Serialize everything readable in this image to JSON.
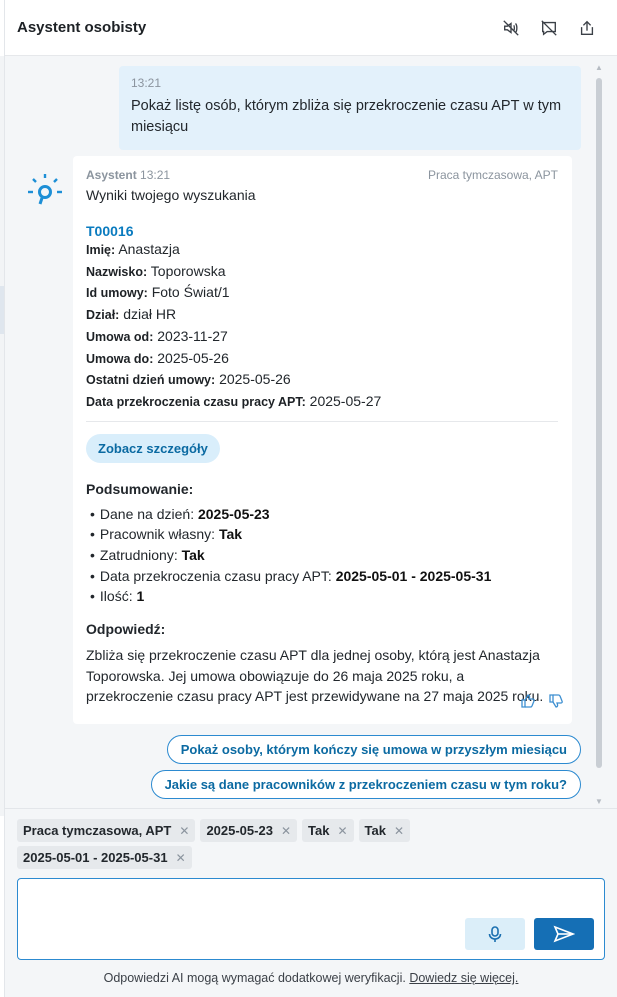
{
  "header": {
    "title": "Asystent osobisty",
    "icons": [
      "speaker-mute-icon",
      "comment-off-icon",
      "share-icon"
    ]
  },
  "user_message": {
    "time": "13:21",
    "text": "Pokaż listę osób, którym zbliża się przekroczenie czasu APT w tym miesiącu"
  },
  "bot_message": {
    "author": "Asystent",
    "time": "13:21",
    "context": "Praca tymczasowa, APT",
    "intro": "Wyniki twojego wyszukania",
    "record_id": "T00016",
    "fields": [
      {
        "label": "Imię:",
        "value": "Anastazja"
      },
      {
        "label": "Nazwisko:",
        "value": "Toporowska"
      },
      {
        "label": "Id umowy:",
        "value": "Foto Świat/1"
      },
      {
        "label": "Dział:",
        "value": "dział HR"
      },
      {
        "label": "Umowa od:",
        "value": "2023-11-27"
      },
      {
        "label": "Umowa do:",
        "value": "2025-05-26"
      },
      {
        "label": "Ostatni dzień umowy:",
        "value": "2025-05-26"
      },
      {
        "label": "Data przekroczenia czasu pracy APT:",
        "value": "2025-05-27"
      }
    ],
    "details_button": "Zobacz szczegóły",
    "summary_title": "Podsumowanie:",
    "summary": [
      {
        "label": "Dane na dzień: ",
        "value": "2025-05-23"
      },
      {
        "label": "Pracownik własny: ",
        "value": "Tak"
      },
      {
        "label": "Zatrudniony: ",
        "value": "Tak"
      },
      {
        "label": "Data przekroczenia czasu pracy APT: ",
        "value": "2025-05-01 - 2025-05-31"
      },
      {
        "label": "Ilość: ",
        "value": "1"
      }
    ],
    "answer_title": "Odpowiedź:",
    "answer": "Zbliża się przekroczenie czasu APT dla jednej osoby, którą jest Anastazja Toporowska. Jej umowa obowiązuje do 26 maja 2025 roku, a przekroczenie czasu pracy APT jest przewidywane na 27 maja 2025 roku."
  },
  "suggestions": [
    "Pokaż osoby, którym kończy się umowa w przyszłym miesiącu",
    "Jakie są dane pracowników z przekroczeniem czasu w tym roku?"
  ],
  "filter_chips": [
    "Praca tymczasowa, APT",
    "2025-05-23",
    "Tak",
    "Tak",
    "2025-05-01 - 2025-05-31"
  ],
  "input": {
    "value": "",
    "placeholder": ""
  },
  "footer": {
    "disclaimer": "Odpowiedzi AI mogą wymagać dodatkowej weryfikacji.",
    "link": "Dowiedz się więcej."
  },
  "colors": {
    "accent": "#156fb5",
    "link": "#0a7bbf",
    "user_bubble": "#e3f1fb",
    "chat_background": "#f4f6f8"
  }
}
